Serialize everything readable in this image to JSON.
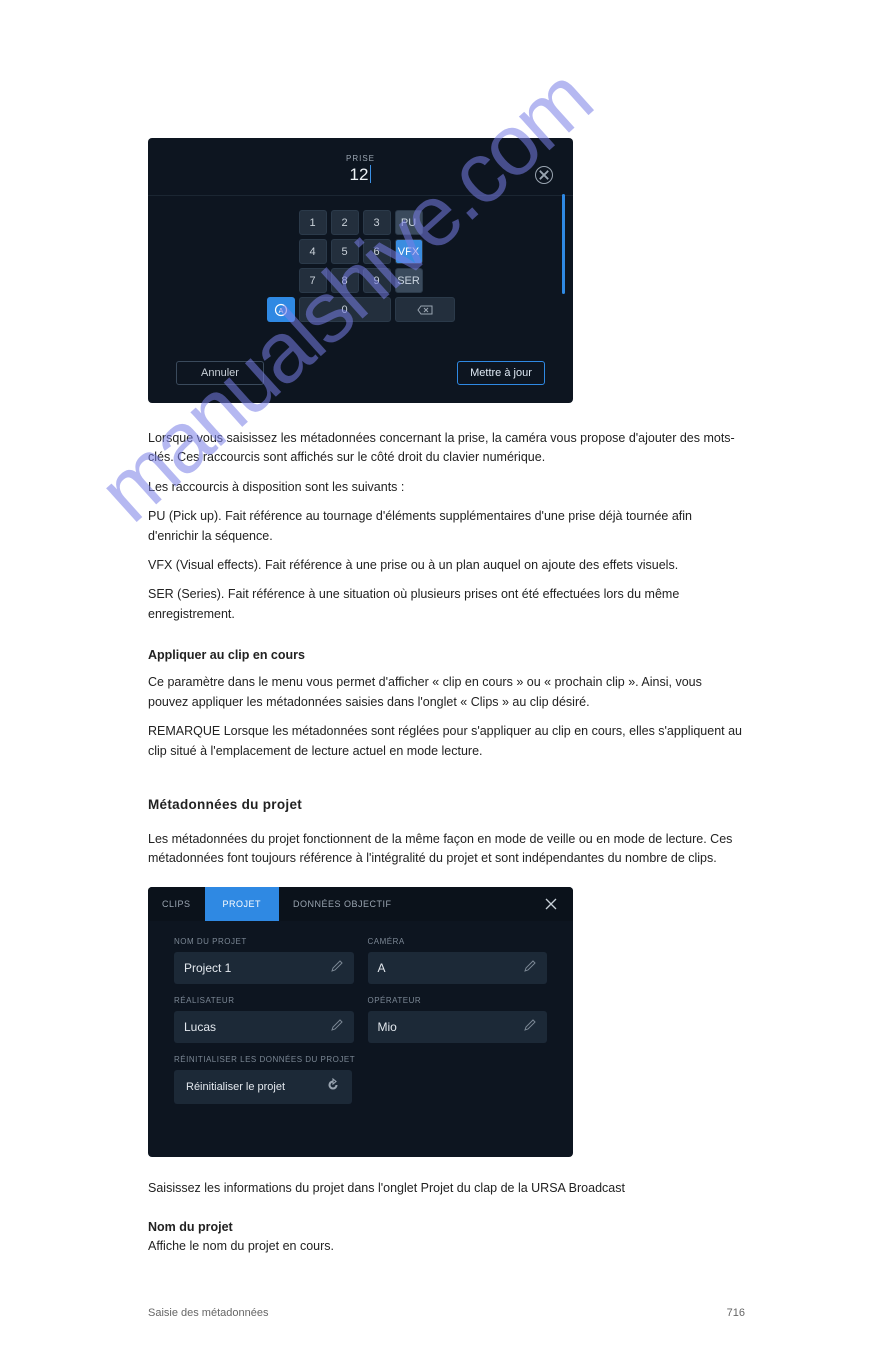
{
  "watermark": "manualshive.com",
  "panel1": {
    "title": "PRISE",
    "value": "12",
    "keys": {
      "r1": [
        "1",
        "2",
        "3"
      ],
      "r1x": "PU",
      "r2": [
        "4",
        "5",
        "6"
      ],
      "r2x": "VFX",
      "r3": [
        "7",
        "8",
        "9"
      ],
      "r3x": "SER",
      "zero": "0",
      "a": "A"
    },
    "cancel": "Annuler",
    "update": "Mettre à jour"
  },
  "text1": {
    "p1": "Lorsque vous saisissez les métadonnées concernant la prise, la caméra vous propose d'ajouter des mots-clés. Ces raccourcis sont affichés sur le côté droit du clavier numérique.",
    "p2": "Les raccourcis à disposition sont les suivants :",
    "list": [
      "PU (Pick up). Fait référence au tournage d'éléments supplémentaires d'une prise déjà tournée afin d'enrichir la séquence.",
      "VFX (Visual effects). Fait référence à une prise ou à un plan auquel on ajoute des effets visuels.",
      "SER (Series). Fait référence à une situation où plusieurs prises ont été effectuées lors du même enregistrement."
    ],
    "sub": "Appliquer au clip en cours",
    "p3": "Ce paramètre dans le menu vous permet d'afficher « clip en cours » ou « prochain clip ». Ainsi, vous pouvez appliquer les métadonnées saisies dans l'onglet « Clips » au clip désiré.",
    "p4": "REMARQUE Lorsque les métadonnées sont réglées pour s'appliquer au clip en cours, elles s'appliquent au clip situé à l'emplacement de lecture actuel en mode lecture.",
    "h2": "Métadonnées du projet",
    "p5": "Les métadonnées du projet fonctionnent de la même façon en mode de veille ou en mode de lecture. Ces métadonnées font toujours référence à l'intégralité du projet et sont indépendantes du nombre de clips."
  },
  "panel2": {
    "tabs": [
      "CLIPS",
      "PROJET",
      "DONNÉES OBJECTIF"
    ],
    "activeTab": 1,
    "fields": {
      "project_label": "NOM DU PROJET",
      "project_value": "Project 1",
      "camera_label": "CAMÉRA",
      "camera_value": "A",
      "director_label": "RÉALISATEUR",
      "director_value": "Lucas",
      "operator_label": "OPÉRATEUR",
      "operator_value": "Mio"
    },
    "reset_label": "RÉINITIALISER LES DONNÉES DU PROJET",
    "reset_button": "Réinitialiser le projet"
  },
  "footer_caption": "Saisissez les informations du projet dans l'onglet Projet du clap de la URSA Broadcast",
  "section_title": "Nom du projet",
  "section_body": "Affiche le nom du projet en cours.",
  "page_left": "Saisie des métadonnées",
  "page_right": "716"
}
